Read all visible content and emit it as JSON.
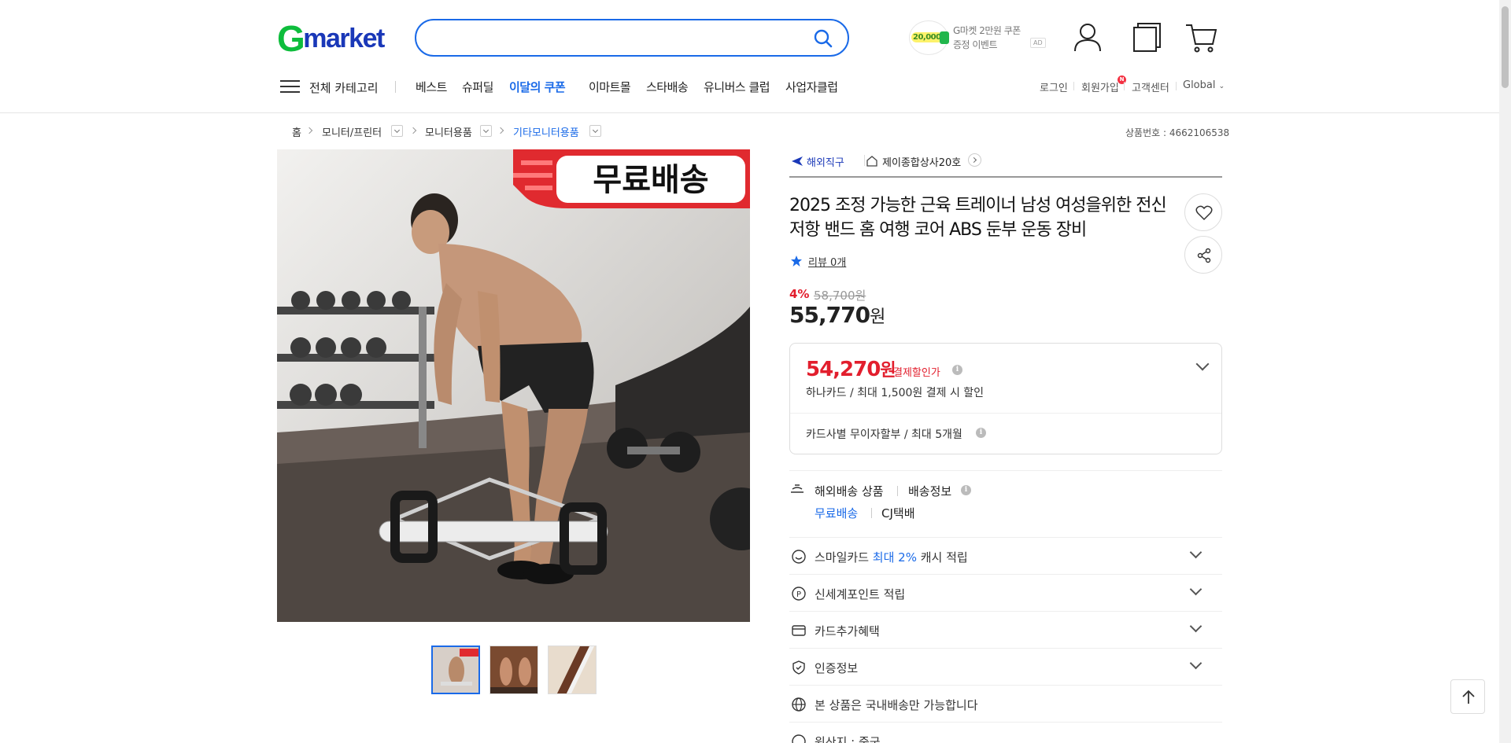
{
  "header": {
    "logo_g": "G",
    "logo_rest": "market",
    "search": {
      "placeholder": "",
      "value": ""
    },
    "promo": {
      "amount": "20,000",
      "line1": "G마켓 2만원 쿠폰",
      "line2": "증정 이벤트",
      "ad": "AD"
    }
  },
  "nav": {
    "all_categories": "전체 카테고리",
    "items": [
      "베스트",
      "슈퍼딜",
      "이달의 쿠폰",
      "이마트몰",
      "스타배송",
      "유니버스 클럽",
      "사업자클럽"
    ],
    "new_badge": "N",
    "util": [
      "로그인",
      "회원가입",
      "고객센터",
      "Global"
    ]
  },
  "breadcrumb": {
    "items": [
      "홈",
      "모니터/프린터",
      "모니터용품",
      "기타모니터용품"
    ],
    "product_no": "상품번호 : 4662106538"
  },
  "image": {
    "badge_text": "무료배송"
  },
  "product": {
    "shipping_tag": "해외직구",
    "seller": "제이종합상사20호",
    "title": "2025 조정 가능한 근육 트레이너 남성 여성을위한 전신 저항 밴드 홈 여행 코어 ABS 둔부 운동 장비",
    "review": "리뷰 0개",
    "discount": "4%",
    "original_price": "58,700원",
    "price_num": "55,770",
    "price_unit": "원"
  },
  "card_offer": {
    "price_num": "54,270",
    "price_unit": "원",
    "label": "결제할인가",
    "sub": "하나카드 / 최대 1,500원 결제 시 할인",
    "installment": "카드사별 무이자할부 / 최대 5개월"
  },
  "shipping": {
    "type": "해외배송 상품",
    "info": "배송정보",
    "free": "무료배송",
    "carrier": "CJ택배"
  },
  "benefits": [
    {
      "pre": "스마일카드 ",
      "hl": "최대 2%",
      "post": " 캐시 적립"
    },
    {
      "pre": "신세계포인트 적립",
      "hl": "",
      "post": ""
    },
    {
      "pre": "카드추가혜택",
      "hl": "",
      "post": ""
    },
    {
      "pre": "인증정보",
      "hl": "",
      "post": ""
    },
    {
      "pre": "본 상품은 국내배송만 가능합니다",
      "hl": "",
      "post": ""
    },
    {
      "pre": "원산지 : 중국",
      "hl": "",
      "post": ""
    }
  ],
  "colors": {
    "accent": "#1a6ae8",
    "brand_green": "#0ebd3c",
    "brand_blue": "#1a38b8",
    "sale_red": "#e21e2d"
  }
}
